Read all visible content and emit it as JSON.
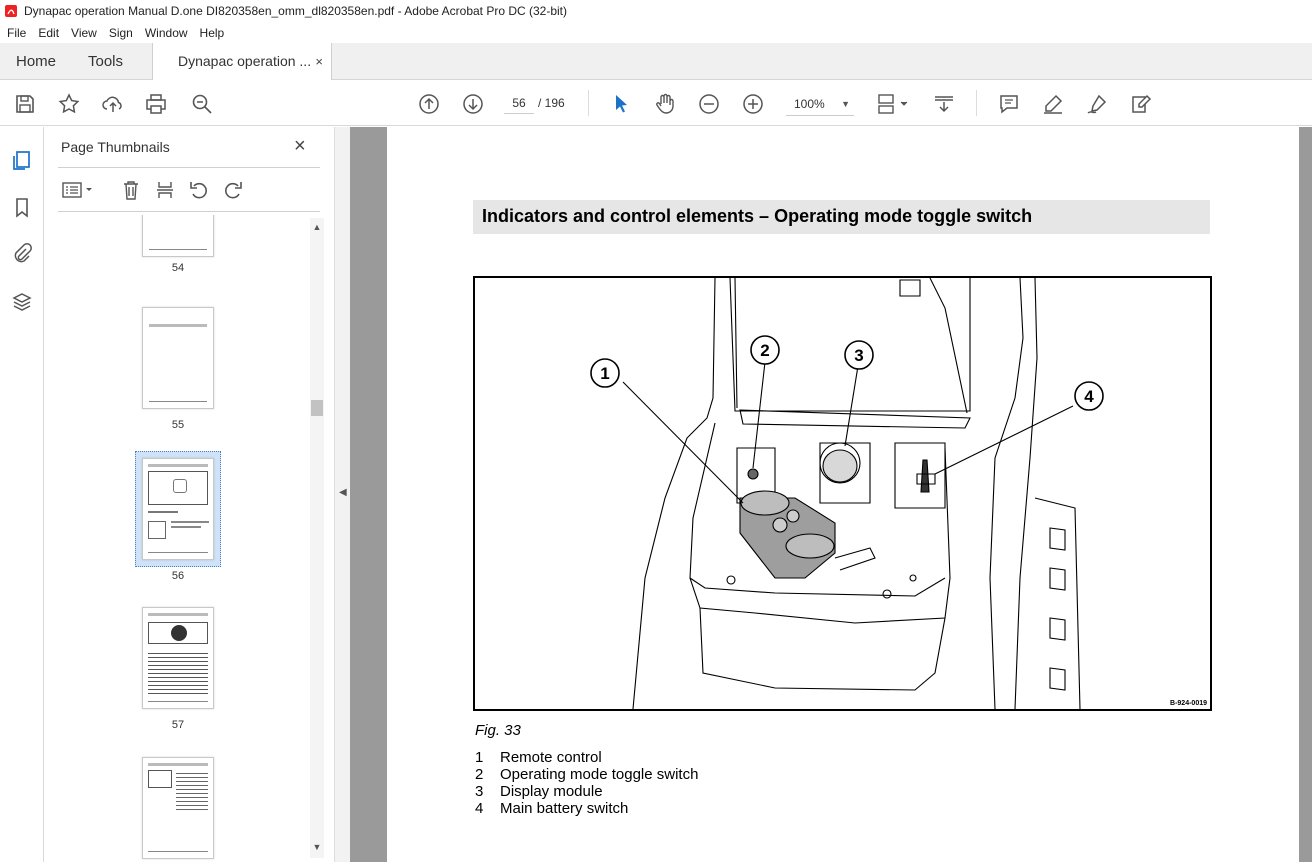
{
  "window": {
    "title": "Dynapac operation Manual D.one DI820358en_omm_dl820358en.pdf - Adobe Acrobat Pro DC (32-bit)"
  },
  "menu": [
    "File",
    "Edit",
    "View",
    "Sign",
    "Window",
    "Help"
  ],
  "tabs": {
    "home": "Home",
    "tools": "Tools",
    "document": "Dynapac operation ...",
    "close": "×"
  },
  "toolbar": {
    "current_page": "56",
    "page_total": "/  196",
    "zoom": "100%"
  },
  "thumbnails_panel": {
    "title": "Page Thumbnails",
    "close": "×",
    "items": [
      {
        "label": "54"
      },
      {
        "label": "55"
      },
      {
        "label": "56",
        "selected": true
      },
      {
        "label": "57"
      },
      {
        "label": ""
      }
    ]
  },
  "document": {
    "heading": "Indicators and control elements – Operating mode toggle switch",
    "figure_code": "B-924-0019",
    "callouts": [
      "1",
      "2",
      "3",
      "4"
    ],
    "caption": "Fig.  33",
    "legend": [
      {
        "num": "1",
        "text": "Remote control"
      },
      {
        "num": "2",
        "text": "Operating mode toggle switch"
      },
      {
        "num": "3",
        "text": "Display module"
      },
      {
        "num": "4",
        "text": "Main battery switch"
      }
    ]
  }
}
